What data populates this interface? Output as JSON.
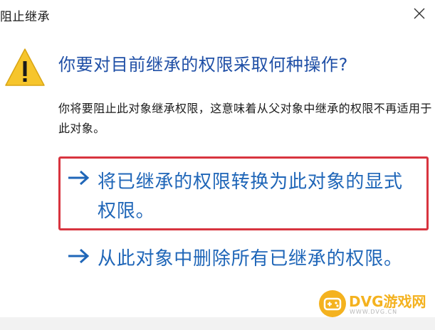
{
  "dialog": {
    "title": "阻止继承",
    "close_icon": "close-icon",
    "warning_icon": "warning-icon"
  },
  "heading": "你要对目前继承的权限采取何种操作?",
  "description": "你将要阻止此对象继承权限，这意味着从父对象中继承的权限不再适用于此对象。",
  "options": [
    {
      "icon": "arrow-right-icon",
      "label": "将已继承的权限转换为此对象的显式权限。",
      "highlighted": true
    },
    {
      "icon": "arrow-right-icon",
      "label": "从此对象中删除所有已继承的权限。",
      "highlighted": false
    }
  ],
  "watermark": {
    "text": "DVG游戏网",
    "subtext": "WWW.DVG.CN"
  },
  "colors": {
    "heading": "#1f4fa6",
    "link": "#1f66b8",
    "highlight_border": "#d8343f",
    "warning_fill": "#f6c52c",
    "watermark": "#f4b21f"
  }
}
